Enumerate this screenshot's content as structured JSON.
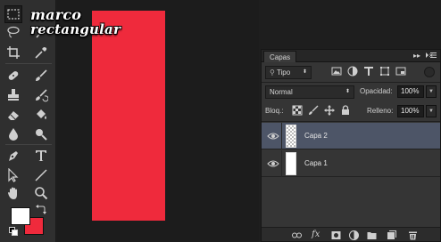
{
  "overlay": {
    "line1": "marco",
    "line2": "rectangular"
  },
  "canvas": {
    "shape_color": "#ef2a3c",
    "background": "#1c1c1c"
  },
  "toolbox": {
    "tools": [
      "marquee-icon",
      "lasso-icon",
      "magic-wand-icon",
      "crop-icon",
      "eyedropper-icon",
      "healing-icon",
      "brush-icon",
      "stamp-icon",
      "history-brush-icon",
      "eraser-icon",
      "paint-bucket-icon",
      "blur-icon",
      "dodge-icon",
      "pen-icon",
      "type-icon",
      "path-select-icon",
      "line-icon",
      "hand-icon",
      "zoom-icon"
    ],
    "foreground_color": "#ffffff",
    "background_color": "#ef2a3c"
  },
  "layers_panel": {
    "tab_label": "Capas",
    "collapse_label": "▸▸",
    "close_label": "×",
    "filter": {
      "kind_label": "Tipo"
    },
    "blend_mode": "Normal",
    "opacity_label": "Opacidad:",
    "opacity_value": "100%",
    "lock_label": "Bloq.:",
    "fill_label": "Relleno:",
    "fill_value": "100%",
    "layers": [
      {
        "name": "Capa 2",
        "selected": true,
        "visible": true,
        "thumb": "transparent"
      },
      {
        "name": "Capa 1",
        "selected": false,
        "visible": true,
        "thumb": "white"
      }
    ],
    "footer_fx": "fx"
  }
}
